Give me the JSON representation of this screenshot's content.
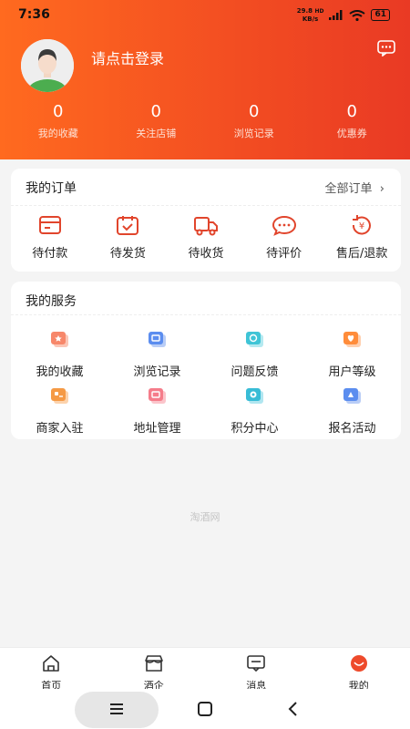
{
  "status_bar": {
    "time": "7:36",
    "speed_value": "29.8",
    "speed_unit": "KB/s",
    "network": "HD",
    "battery": "61"
  },
  "profile": {
    "login_prompt": "请点击登录",
    "message_icon": "chat-bubble-icon"
  },
  "stats": [
    {
      "value": "0",
      "label": "我的收藏"
    },
    {
      "value": "0",
      "label": "关注店铺"
    },
    {
      "value": "0",
      "label": "浏览记录"
    },
    {
      "value": "0",
      "label": "优惠券"
    }
  ],
  "orders": {
    "title": "我的订单",
    "all_label": "全部订单",
    "items": [
      {
        "label": "待付款",
        "icon": "wallet-icon"
      },
      {
        "label": "待发货",
        "icon": "package-icon"
      },
      {
        "label": "待收货",
        "icon": "truck-icon"
      },
      {
        "label": "待评价",
        "icon": "comment-icon"
      },
      {
        "label": "售后/退款",
        "icon": "refund-icon"
      }
    ]
  },
  "services": {
    "title": "我的服务",
    "items": [
      {
        "label": "我的收藏",
        "icon": "favorites-icon",
        "color": "#f7876a"
      },
      {
        "label": "浏览记录",
        "icon": "history-icon",
        "color": "#5b8def"
      },
      {
        "label": "问题反馈",
        "icon": "feedback-icon",
        "color": "#3fc4d6"
      },
      {
        "label": "用户等级",
        "icon": "level-icon",
        "color": "#ff8c3a"
      },
      {
        "label": "商家入驻",
        "icon": "merchant-icon",
        "color": "#f59a45"
      },
      {
        "label": "地址管理",
        "icon": "address-icon",
        "color": "#f57c8a"
      },
      {
        "label": "积分中心",
        "icon": "points-icon",
        "color": "#38bcd6"
      },
      {
        "label": "报名活动",
        "icon": "activity-icon",
        "color": "#5b8def"
      }
    ]
  },
  "brand_footer": "淘酒网",
  "tabs": [
    {
      "label": "首页",
      "icon": "home-icon"
    },
    {
      "label": "酒企",
      "icon": "store-icon"
    },
    {
      "label": "消息",
      "icon": "message-icon"
    },
    {
      "label": "我的",
      "icon": "profile-icon",
      "active": true
    }
  ],
  "colors": {
    "accent": "#f24c22",
    "order_icon": "#e1452c"
  }
}
